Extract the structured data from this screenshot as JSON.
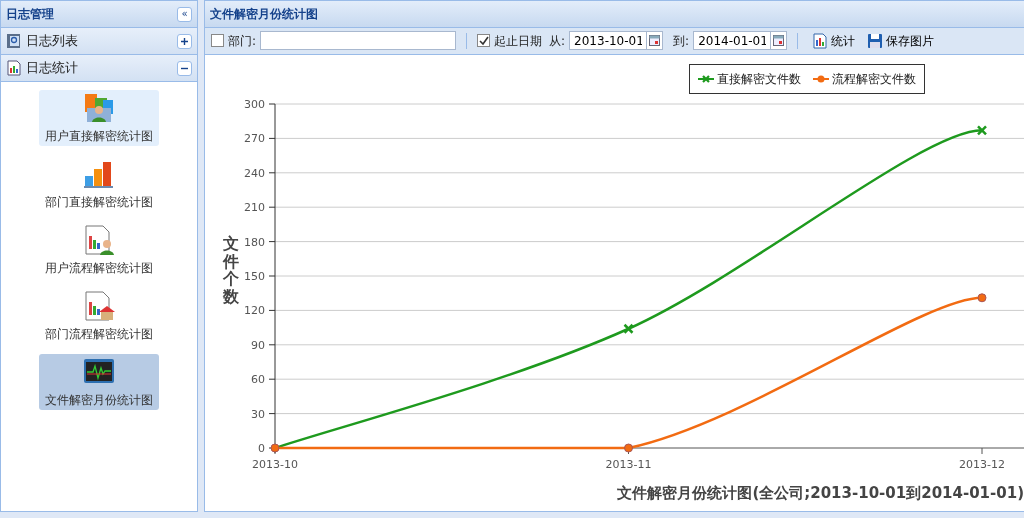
{
  "left_panel": {
    "title": "日志管理",
    "collapse_glyph": "«",
    "sections": [
      {
        "label": "日志列表",
        "expanded": false
      },
      {
        "label": "日志统计",
        "expanded": true
      }
    ],
    "items": [
      {
        "label": "用户直接解密统计图",
        "hovered": true,
        "selected": false
      },
      {
        "label": "部门直接解密统计图",
        "hovered": false,
        "selected": false
      },
      {
        "label": "用户流程解密统计图",
        "hovered": false,
        "selected": false
      },
      {
        "label": "部门流程解密统计图",
        "hovered": false,
        "selected": false
      },
      {
        "label": "文件解密月份统计图",
        "hovered": false,
        "selected": true
      }
    ]
  },
  "main_panel": {
    "title": "文件解密月份统计图",
    "toolbar": {
      "dept": {
        "label": "部门:",
        "checked": false
      },
      "date_range": {
        "label": "起止日期",
        "checked": true,
        "from_label": "从:",
        "from": "2013-10-01",
        "to_label": "到:",
        "to": "2014-01-01"
      },
      "buttons": [
        {
          "label": "统计"
        },
        {
          "label": "保存图片"
        }
      ]
    },
    "chart_data": {
      "type": "line",
      "title": "文件解密月份统计图(全公司;2013-10-01到2014-01-01)",
      "ylabel": "文件个数",
      "categories": [
        "2013-10",
        "2013-11",
        "2013-12"
      ],
      "series": [
        {
          "name": "直接解密文件数",
          "color": "#1e9a1e",
          "marker": "x",
          "values": [
            0,
            104,
            277
          ]
        },
        {
          "name": "流程解密文件数",
          "color": "#f26b12",
          "marker": "circle",
          "values": [
            0,
            0,
            131
          ]
        }
      ],
      "grid": true,
      "legend": true,
      "ylim": [
        0,
        300
      ],
      "yticks": [
        0,
        30,
        60,
        90,
        120,
        150,
        180,
        210,
        240,
        270,
        300
      ]
    }
  }
}
